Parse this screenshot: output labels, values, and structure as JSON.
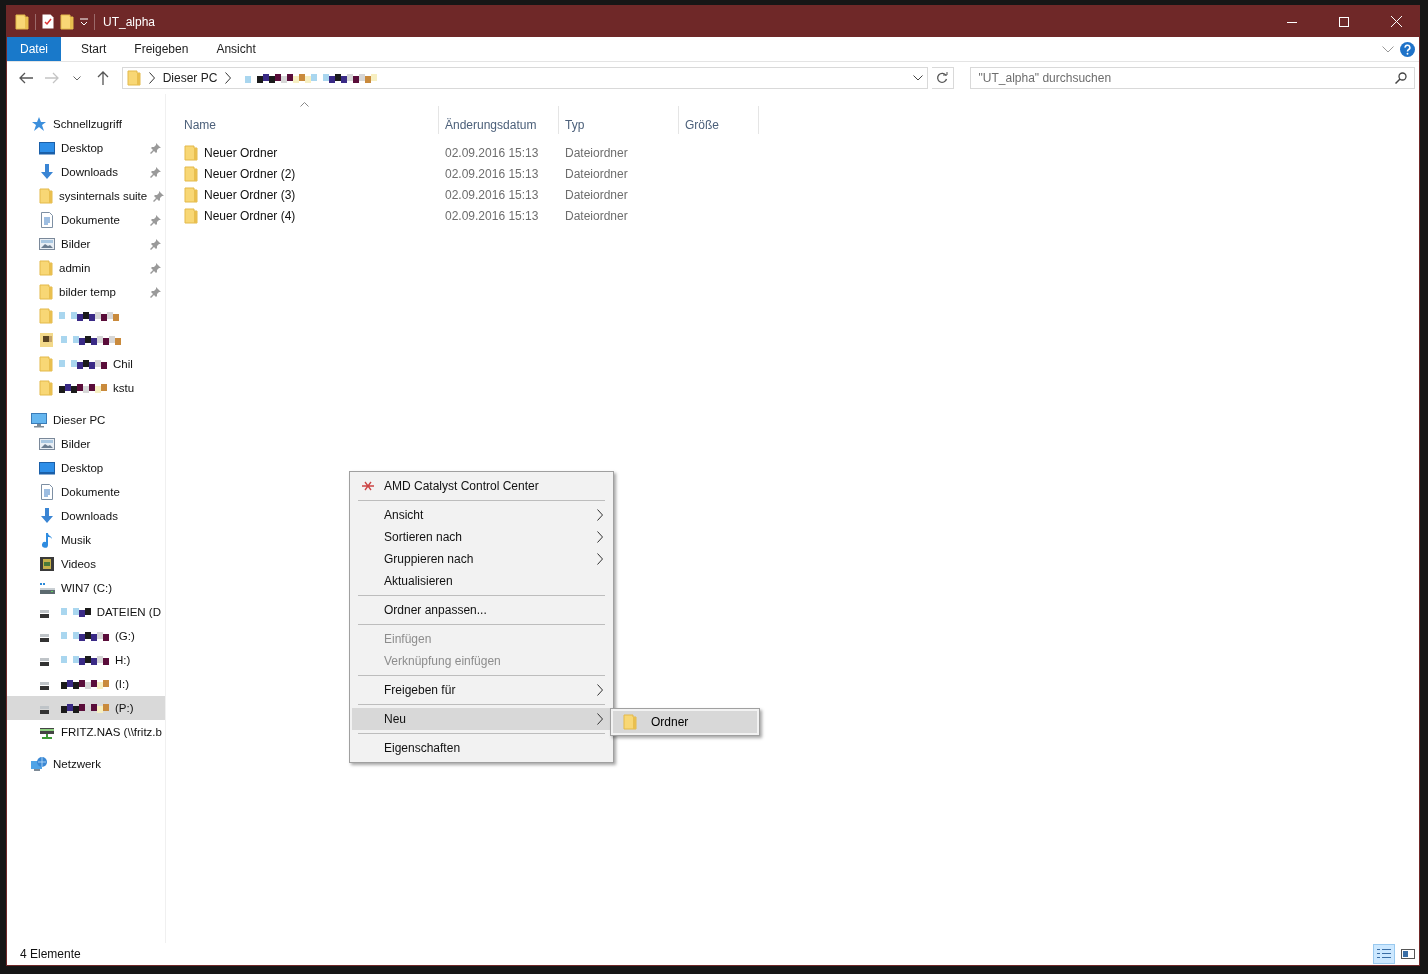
{
  "window": {
    "title": "UT_alpha"
  },
  "ribbon": {
    "tabs": [
      {
        "label": "Datei",
        "selected": true
      },
      {
        "label": "Start",
        "selected": false
      },
      {
        "label": "Freigeben",
        "selected": false
      },
      {
        "label": "Ansicht",
        "selected": false
      }
    ]
  },
  "address_bar": {
    "path": [
      {
        "kind": "text",
        "label": "Dieser PC"
      },
      {
        "kind": "redacted"
      }
    ]
  },
  "search": {
    "placeholder": "\"UT_alpha\" durchsuchen"
  },
  "navigation": [
    {
      "label": "Schnellzugriff",
      "kind": "star",
      "children": [
        {
          "label": "Desktop",
          "kind": "desktop",
          "pinned": true,
          "selected": false
        },
        {
          "label": "Downloads",
          "kind": "download",
          "pinned": true,
          "selected": false
        },
        {
          "label": "sysinternals suite",
          "kind": "folder",
          "pinned": true,
          "selected": false
        },
        {
          "label": "Dokumente",
          "kind": "document",
          "pinned": true,
          "selected": false
        },
        {
          "label": "Bilder",
          "kind": "pictures",
          "pinned": true,
          "selected": false
        },
        {
          "label": "admin",
          "kind": "folder",
          "pinned": true,
          "selected": false
        },
        {
          "label": "bilder temp",
          "kind": "folder",
          "pinned": true,
          "selected": false
        },
        {
          "kind": "folder",
          "redacted": true,
          "pinned": false,
          "selected": false
        },
        {
          "kind": "thumbfolder",
          "redacted": true,
          "pinned": false,
          "selected": false
        },
        {
          "label": "Chil",
          "kind": "folder",
          "redacted": true,
          "pinned": false,
          "selected": false
        },
        {
          "label": "kstu",
          "kind": "folder",
          "redacted": true,
          "pinned": false,
          "selected": false
        }
      ]
    },
    {
      "label": "Dieser PC",
      "kind": "pc",
      "children": [
        {
          "label": "Bilder",
          "kind": "pictures",
          "selected": false
        },
        {
          "label": "Desktop",
          "kind": "desktop",
          "selected": false
        },
        {
          "label": "Dokumente",
          "kind": "document",
          "selected": false
        },
        {
          "label": "Downloads",
          "kind": "download",
          "selected": false
        },
        {
          "label": "Musik",
          "kind": "music",
          "selected": false
        },
        {
          "label": "Videos",
          "kind": "video",
          "selected": false
        },
        {
          "label": "WIN7 (C:)",
          "kind": "sysdrive",
          "selected": false
        },
        {
          "label": "DATEIEN (D",
          "kind": "drive",
          "redacted": true,
          "selected": false
        },
        {
          "label": "(G:)",
          "kind": "drive",
          "redacted": true,
          "selected": false
        },
        {
          "label": "H:)",
          "kind": "drive",
          "redacted": true,
          "selected": false
        },
        {
          "label": "(I:)",
          "kind": "drive",
          "redacted": true,
          "selected": false
        },
        {
          "label": "(P:)",
          "kind": "drive",
          "redacted": true,
          "selected": true
        },
        {
          "label": "FRITZ.NAS (\\\\fritz.b",
          "kind": "netdrive",
          "selected": false
        }
      ]
    },
    {
      "label": "Netzwerk",
      "kind": "network"
    }
  ],
  "file_list": {
    "columns": [
      "Name",
      "Änderungsdatum",
      "Typ",
      "Größe"
    ],
    "rows": [
      {
        "name": "Neuer Ordner",
        "modified": "02.09.2016 15:13",
        "type": "Dateiordner"
      },
      {
        "name": "Neuer Ordner (2)",
        "modified": "02.09.2016 15:13",
        "type": "Dateiordner"
      },
      {
        "name": "Neuer Ordner (3)",
        "modified": "02.09.2016 15:13",
        "type": "Dateiordner"
      },
      {
        "name": "Neuer Ordner (4)",
        "modified": "02.09.2016 15:13",
        "type": "Dateiordner"
      }
    ]
  },
  "context_menu": {
    "items": [
      {
        "kind": "app",
        "label": "AMD Catalyst Control Center",
        "disabled": false,
        "selected": false
      },
      {
        "kind": "separator"
      },
      {
        "kind": "submenu",
        "label": "Ansicht",
        "disabled": false,
        "selected": false
      },
      {
        "kind": "submenu",
        "label": "Sortieren nach",
        "disabled": false,
        "selected": false
      },
      {
        "kind": "submenu",
        "label": "Gruppieren nach",
        "disabled": false,
        "selected": false
      },
      {
        "kind": "command",
        "label": "Aktualisieren",
        "disabled": false,
        "selected": false
      },
      {
        "kind": "separator"
      },
      {
        "kind": "command",
        "label": "Ordner anpassen...",
        "disabled": false,
        "selected": false
      },
      {
        "kind": "separator"
      },
      {
        "kind": "command",
        "label": "Einfügen",
        "disabled": true,
        "selected": false
      },
      {
        "kind": "command",
        "label": "Verknüpfung einfügen",
        "disabled": true,
        "selected": false
      },
      {
        "kind": "separator"
      },
      {
        "kind": "submenu",
        "label": "Freigeben für",
        "disabled": false,
        "selected": false
      },
      {
        "kind": "separator"
      },
      {
        "kind": "submenu",
        "label": "Neu",
        "disabled": false,
        "selected": true
      },
      {
        "kind": "separator"
      },
      {
        "kind": "command",
        "label": "Eigenschaften",
        "disabled": false,
        "selected": false
      }
    ]
  },
  "submenu": {
    "items": [
      {
        "label": "Ordner",
        "selected": true
      }
    ]
  },
  "status_bar": {
    "count": "4 Elemente",
    "views": [
      {
        "kind": "details",
        "selected": true
      },
      {
        "kind": "tiles",
        "selected": false
      }
    ]
  }
}
